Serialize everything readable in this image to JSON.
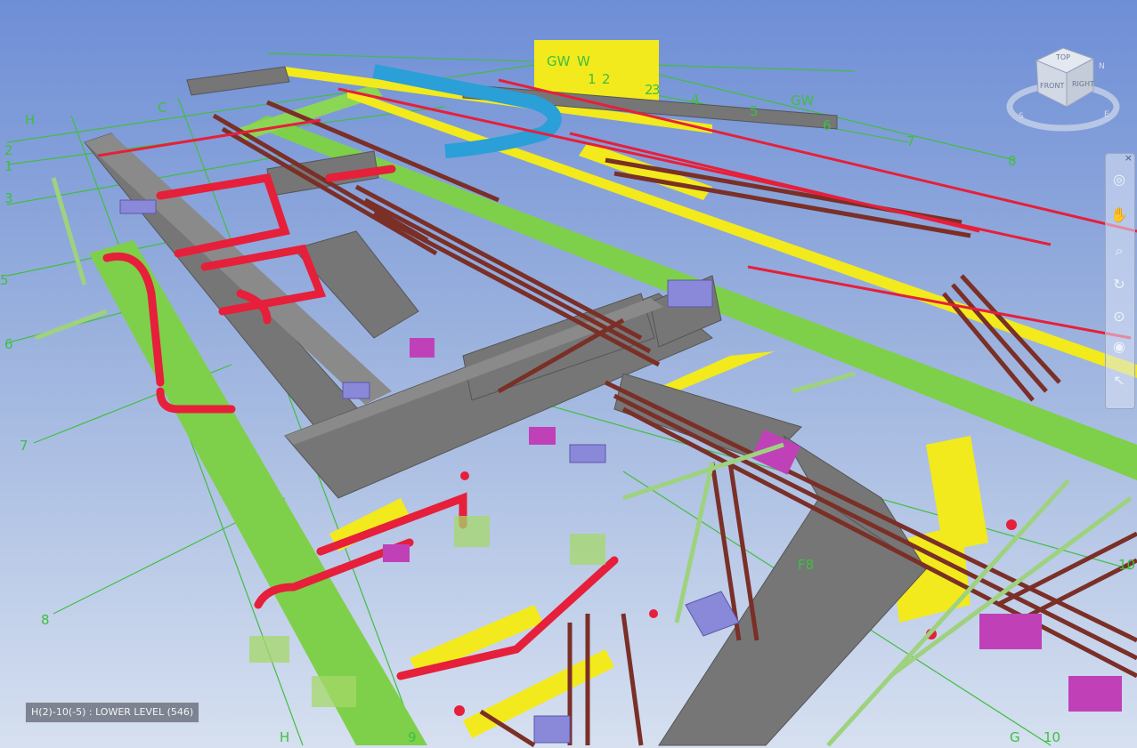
{
  "viewport": {
    "status_label": "H(2)-10(-5) : LOWER LEVEL (546)",
    "background_top": "#6e8ed6",
    "background_bottom": "#d6e0f0"
  },
  "viewcube": {
    "top": "TOP",
    "front": "FRONT",
    "right": "RIGHT",
    "compass_s": "S",
    "compass_e": "E",
    "compass_n": "N"
  },
  "nav_bar": {
    "tools": [
      {
        "icon": "steering-wheel-icon",
        "glyph": "◎"
      },
      {
        "icon": "pan-hand-icon",
        "glyph": "✋"
      },
      {
        "icon": "zoom-icon",
        "glyph": "⌕"
      },
      {
        "icon": "orbit-icon",
        "glyph": "↻"
      },
      {
        "icon": "walk-icon",
        "glyph": "⊙"
      },
      {
        "icon": "look-icon",
        "glyph": "◉"
      },
      {
        "icon": "select-arrow-icon",
        "glyph": "↖"
      }
    ]
  },
  "grid_labels": {
    "h_top": "H",
    "c_top": "C",
    "g_top": "G",
    "gw_a": "GW",
    "w_a": "W",
    "n1": "1",
    "n2": "2",
    "n2b": "2",
    "n3": "3",
    "n4": "4",
    "n5": "5",
    "n6": "6",
    "n7": "7",
    "n8": "8",
    "gw_b": "GW",
    "left_1": "1",
    "left_2": "2",
    "left_3": "3",
    "left_5": "5",
    "left_6": "6",
    "left_7": "7",
    "left_8": "8",
    "bottom_h": "H",
    "bottom_9": "9",
    "f8": "F8",
    "g_bottom": "G",
    "ten": "10",
    "ten_b": "10",
    "ten_c": "10"
  },
  "colors": {
    "ductwork": "#767676",
    "green_pipe": "#7ed04a",
    "red_pipe": "#e61f3a",
    "brown_pipe": "#7a2f27",
    "yellow": "#f2ea1c",
    "magenta": "#c040b8",
    "blue_duct": "#2a9fd8",
    "lavender": "#8a88d8",
    "grid_line": "#3fbf3f"
  }
}
